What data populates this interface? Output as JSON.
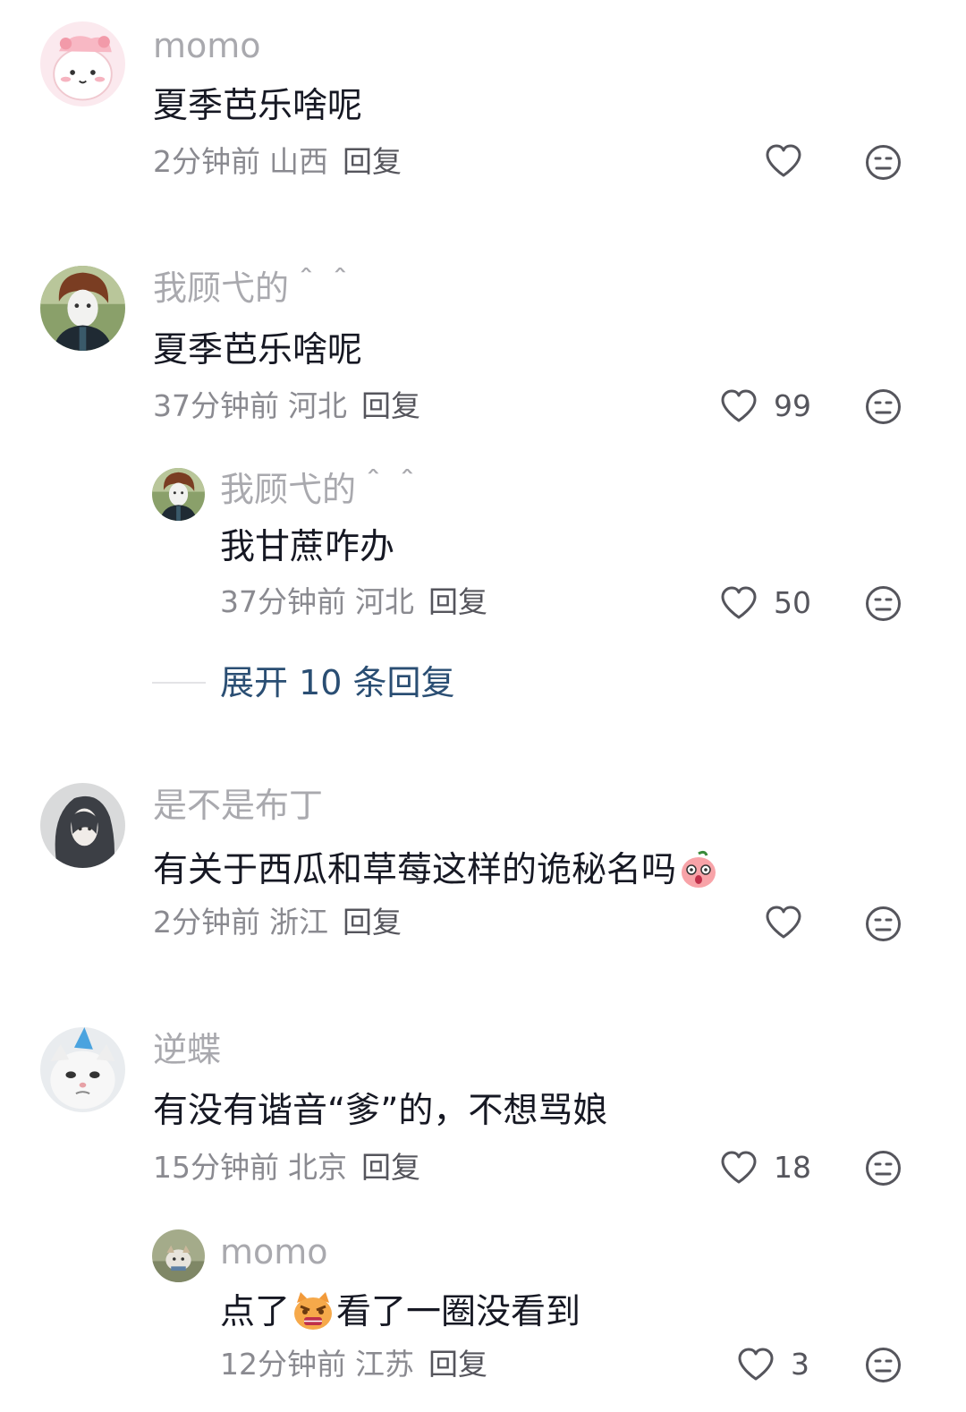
{
  "comments": [
    {
      "user": "momo",
      "text": "夏季芭乐啥呢",
      "time": "2分钟前",
      "location": "山西",
      "reply": "回复",
      "likes": ""
    },
    {
      "user": "我顾弋的＾＾",
      "text": "夏季芭乐啥呢",
      "time": "37分钟前",
      "location": "河北",
      "reply": "回复",
      "likes": "99"
    },
    {
      "user": "我顾弋的＾＾",
      "text": "我甘蔗咋办",
      "time": "37分钟前",
      "location": "河北",
      "reply": "回复",
      "likes": "50"
    },
    {
      "user": "是不是布丁",
      "text": "有关于西瓜和草莓这样的诡秘名吗",
      "time": "2分钟前",
      "location": "浙江",
      "reply": "回复",
      "likes": ""
    },
    {
      "user": "逆蝶",
      "text": "有没有谐音“爹”的，不想骂娘",
      "time": "15分钟前",
      "location": "北京",
      "reply": "回复",
      "likes": "18"
    },
    {
      "user": "momo",
      "text_a": "点了",
      "text_b": "看了一圈没看到",
      "time": "12分钟前",
      "location": "江苏",
      "reply": "回复",
      "likes": "3"
    }
  ],
  "expand_replies": "展开 10 条回复",
  "icons": {
    "like": "heart-outline-icon",
    "dislike": "meh-face-icon"
  },
  "colors": {
    "username": "#a9a9ae",
    "text": "#161823",
    "meta": "#8a8a90",
    "expand": "#2a4e73"
  }
}
